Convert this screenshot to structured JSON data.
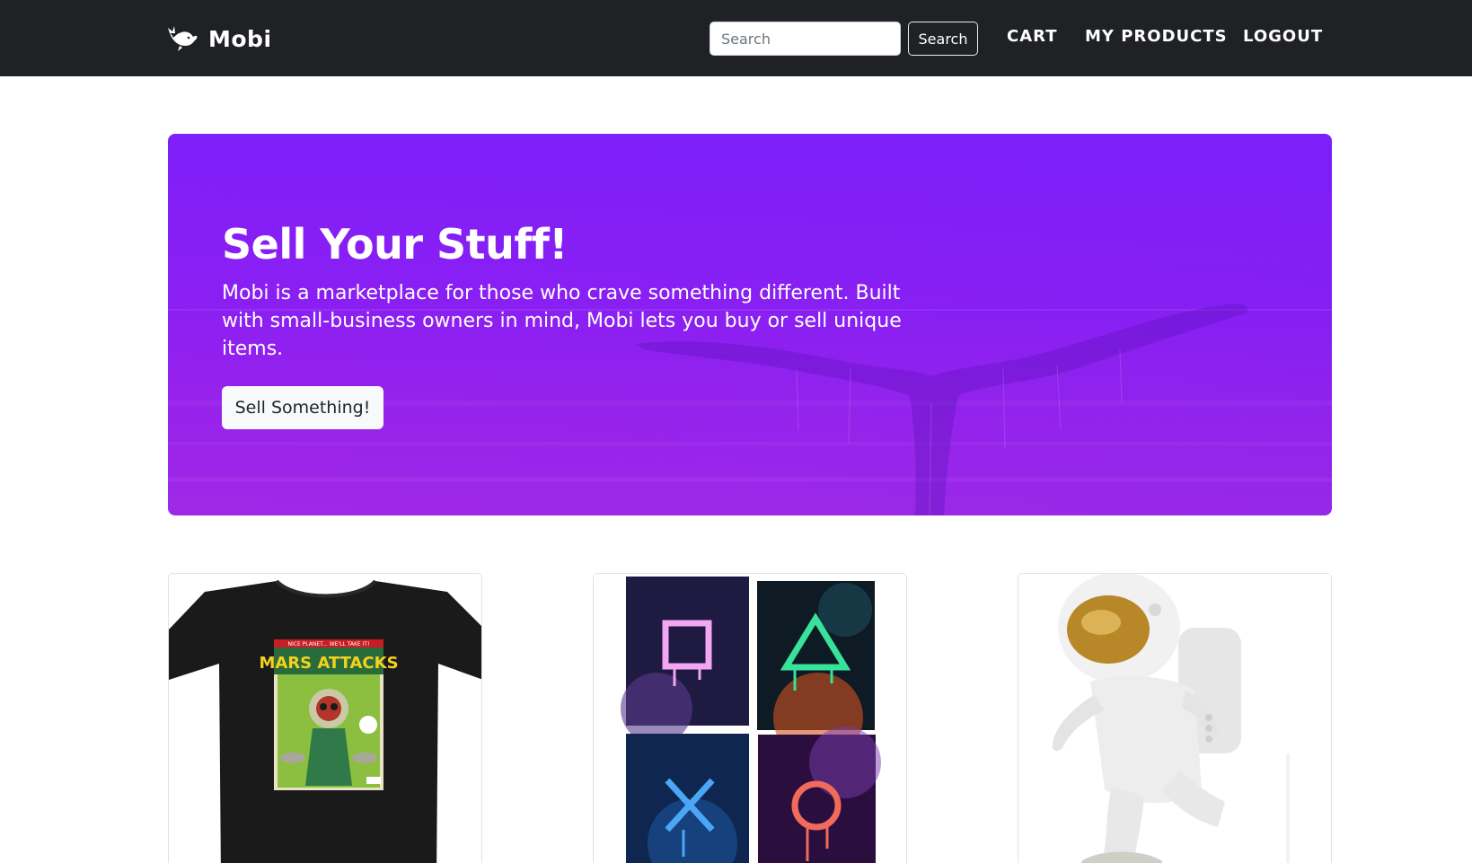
{
  "brand": {
    "name": "Mobi",
    "logo_icon": "whale-icon"
  },
  "header": {
    "search_placeholder": "Search",
    "search_button": "Search",
    "nav": {
      "cart": "CART",
      "my_products": "MY PRODUCTS",
      "logout": "LOGOUT"
    }
  },
  "hero": {
    "title": "Sell Your Stuff!",
    "text": "Mobi is a marketplace for those who crave something different. Built with small-business owners in mind, Mobi lets you buy or sell unique items.",
    "button": "Sell Something!",
    "background_image": "whale-tail-ocean",
    "gradient_colors": [
      "#7e1ff9",
      "#a21ae3"
    ]
  },
  "products": [
    {
      "image": "mars-attacks-tshirt",
      "shirt_text": "MARS ATTACKS",
      "shirt_banner": "NICE PLANET... WE'LL TAKE IT!"
    },
    {
      "image": "game-symbol-canvas-prints"
    },
    {
      "image": "astronaut-figurine"
    }
  ],
  "colors": {
    "navbar": "#1f2125",
    "accent": "#8a1ff5"
  }
}
